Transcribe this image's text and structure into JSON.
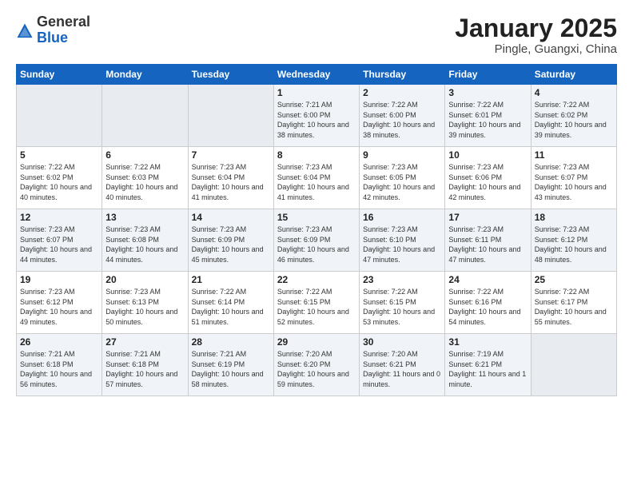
{
  "header": {
    "logo": {
      "general": "General",
      "blue": "Blue"
    },
    "title": "January 2025",
    "subtitle": "Pingle, Guangxi, China"
  },
  "days_of_week": [
    "Sunday",
    "Monday",
    "Tuesday",
    "Wednesday",
    "Thursday",
    "Friday",
    "Saturday"
  ],
  "weeks": [
    [
      {
        "day": "",
        "empty": true
      },
      {
        "day": "",
        "empty": true
      },
      {
        "day": "",
        "empty": true
      },
      {
        "day": "1",
        "sunrise": "7:21 AM",
        "sunset": "6:00 PM",
        "daylight": "10 hours and 38 minutes."
      },
      {
        "day": "2",
        "sunrise": "7:22 AM",
        "sunset": "6:00 PM",
        "daylight": "10 hours and 38 minutes."
      },
      {
        "day": "3",
        "sunrise": "7:22 AM",
        "sunset": "6:01 PM",
        "daylight": "10 hours and 39 minutes."
      },
      {
        "day": "4",
        "sunrise": "7:22 AM",
        "sunset": "6:02 PM",
        "daylight": "10 hours and 39 minutes."
      }
    ],
    [
      {
        "day": "5",
        "sunrise": "7:22 AM",
        "sunset": "6:02 PM",
        "daylight": "10 hours and 40 minutes."
      },
      {
        "day": "6",
        "sunrise": "7:22 AM",
        "sunset": "6:03 PM",
        "daylight": "10 hours and 40 minutes."
      },
      {
        "day": "7",
        "sunrise": "7:23 AM",
        "sunset": "6:04 PM",
        "daylight": "10 hours and 41 minutes."
      },
      {
        "day": "8",
        "sunrise": "7:23 AM",
        "sunset": "6:04 PM",
        "daylight": "10 hours and 41 minutes."
      },
      {
        "day": "9",
        "sunrise": "7:23 AM",
        "sunset": "6:05 PM",
        "daylight": "10 hours and 42 minutes."
      },
      {
        "day": "10",
        "sunrise": "7:23 AM",
        "sunset": "6:06 PM",
        "daylight": "10 hours and 42 minutes."
      },
      {
        "day": "11",
        "sunrise": "7:23 AM",
        "sunset": "6:07 PM",
        "daylight": "10 hours and 43 minutes."
      }
    ],
    [
      {
        "day": "12",
        "sunrise": "7:23 AM",
        "sunset": "6:07 PM",
        "daylight": "10 hours and 44 minutes."
      },
      {
        "day": "13",
        "sunrise": "7:23 AM",
        "sunset": "6:08 PM",
        "daylight": "10 hours and 44 minutes."
      },
      {
        "day": "14",
        "sunrise": "7:23 AM",
        "sunset": "6:09 PM",
        "daylight": "10 hours and 45 minutes."
      },
      {
        "day": "15",
        "sunrise": "7:23 AM",
        "sunset": "6:09 PM",
        "daylight": "10 hours and 46 minutes."
      },
      {
        "day": "16",
        "sunrise": "7:23 AM",
        "sunset": "6:10 PM",
        "daylight": "10 hours and 47 minutes."
      },
      {
        "day": "17",
        "sunrise": "7:23 AM",
        "sunset": "6:11 PM",
        "daylight": "10 hours and 47 minutes."
      },
      {
        "day": "18",
        "sunrise": "7:23 AM",
        "sunset": "6:12 PM",
        "daylight": "10 hours and 48 minutes."
      }
    ],
    [
      {
        "day": "19",
        "sunrise": "7:23 AM",
        "sunset": "6:12 PM",
        "daylight": "10 hours and 49 minutes."
      },
      {
        "day": "20",
        "sunrise": "7:23 AM",
        "sunset": "6:13 PM",
        "daylight": "10 hours and 50 minutes."
      },
      {
        "day": "21",
        "sunrise": "7:22 AM",
        "sunset": "6:14 PM",
        "daylight": "10 hours and 51 minutes."
      },
      {
        "day": "22",
        "sunrise": "7:22 AM",
        "sunset": "6:15 PM",
        "daylight": "10 hours and 52 minutes."
      },
      {
        "day": "23",
        "sunrise": "7:22 AM",
        "sunset": "6:15 PM",
        "daylight": "10 hours and 53 minutes."
      },
      {
        "day": "24",
        "sunrise": "7:22 AM",
        "sunset": "6:16 PM",
        "daylight": "10 hours and 54 minutes."
      },
      {
        "day": "25",
        "sunrise": "7:22 AM",
        "sunset": "6:17 PM",
        "daylight": "10 hours and 55 minutes."
      }
    ],
    [
      {
        "day": "26",
        "sunrise": "7:21 AM",
        "sunset": "6:18 PM",
        "daylight": "10 hours and 56 minutes."
      },
      {
        "day": "27",
        "sunrise": "7:21 AM",
        "sunset": "6:18 PM",
        "daylight": "10 hours and 57 minutes."
      },
      {
        "day": "28",
        "sunrise": "7:21 AM",
        "sunset": "6:19 PM",
        "daylight": "10 hours and 58 minutes."
      },
      {
        "day": "29",
        "sunrise": "7:20 AM",
        "sunset": "6:20 PM",
        "daylight": "10 hours and 59 minutes."
      },
      {
        "day": "30",
        "sunrise": "7:20 AM",
        "sunset": "6:21 PM",
        "daylight": "11 hours and 0 minutes."
      },
      {
        "day": "31",
        "sunrise": "7:19 AM",
        "sunset": "6:21 PM",
        "daylight": "11 hours and 1 minute."
      },
      {
        "day": "",
        "empty": true
      }
    ]
  ]
}
